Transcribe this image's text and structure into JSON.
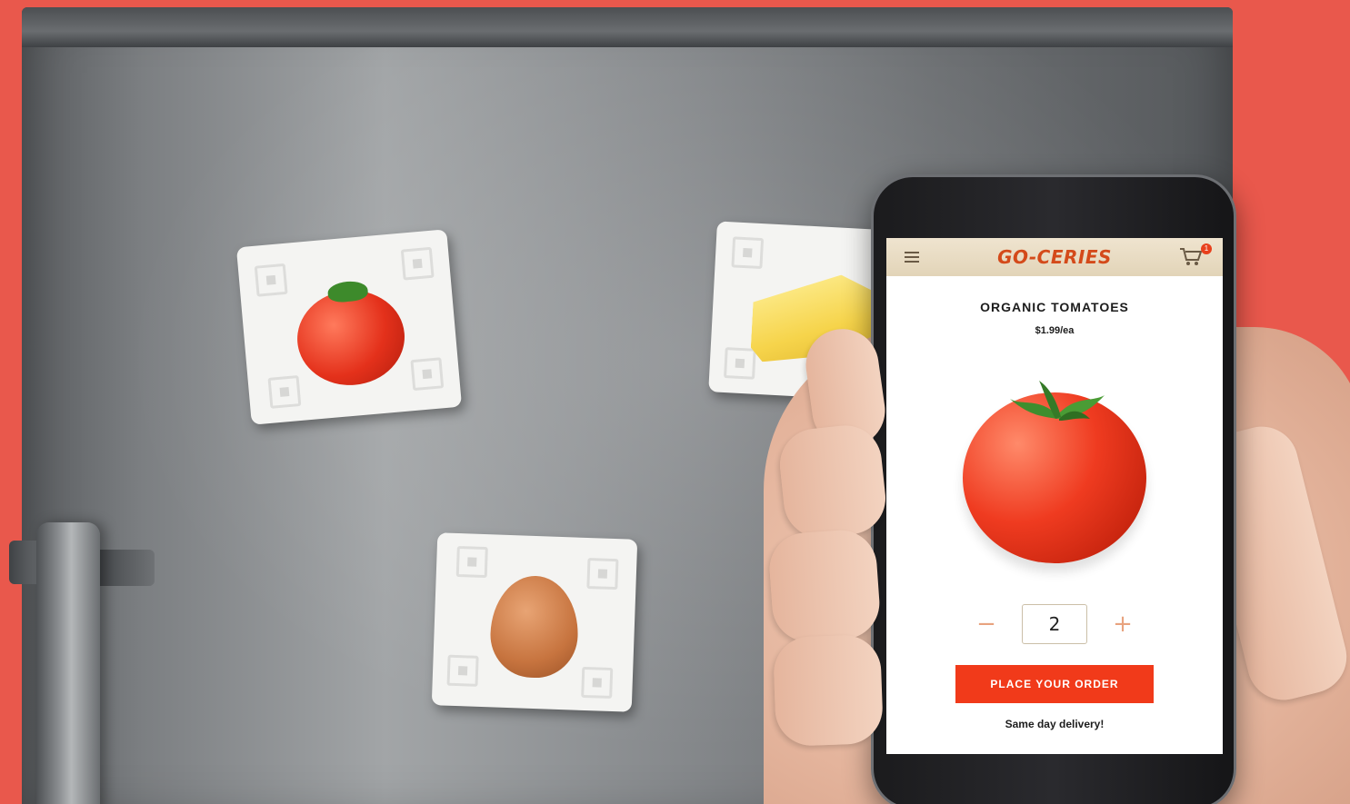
{
  "app": {
    "brand": "GO-CERIES",
    "cart_count": "1"
  },
  "product": {
    "name": "ORGANIC TOMATOES",
    "price": "$1.99/ea",
    "image_icon": "tomato-image"
  },
  "quantity": {
    "decrement_label": "−",
    "value": "2",
    "increment_label": "+"
  },
  "actions": {
    "place_order_label": "PLACE YOUR ORDER"
  },
  "footer": {
    "delivery_note": "Same day delivery!"
  },
  "scene": {
    "magnets": [
      "tomato",
      "cheese",
      "egg"
    ]
  },
  "colors": {
    "background": "#e9584c",
    "brand": "#d44a1a",
    "order_button": "#f13a1a",
    "header_bg": "#efe4cf"
  }
}
